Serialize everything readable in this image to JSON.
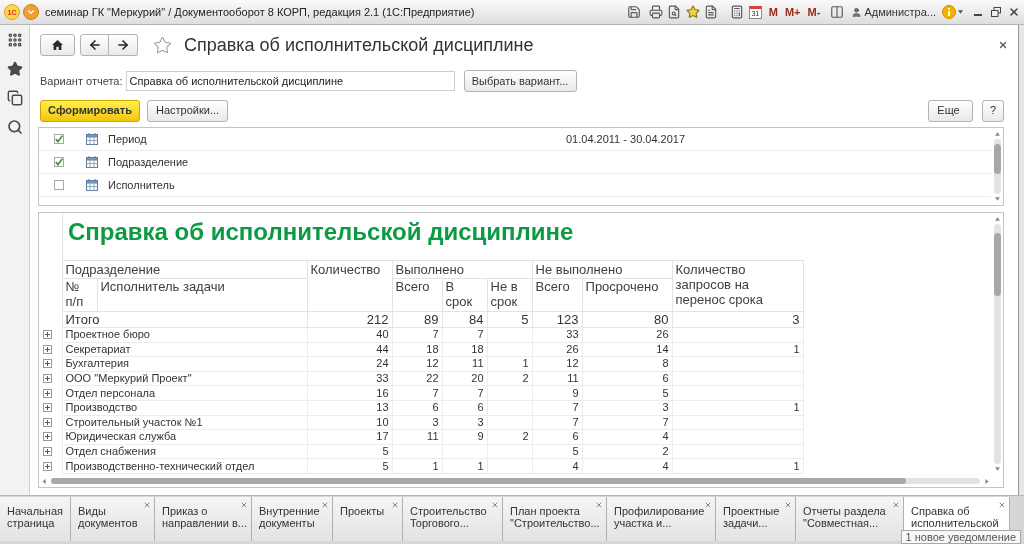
{
  "window": {
    "logo": "1С",
    "title": "семинар ГК \"Меркурий\" / Документооборот 8 КОРП, редакция 2.1 (1С:Предприятие)",
    "calendar_day": "31",
    "memory_buttons": [
      "M",
      "M+",
      "M-"
    ],
    "user": "Администра..."
  },
  "form": {
    "title": "Справка об исполнительской дисциплине",
    "favorite": false
  },
  "variant": {
    "label": "Вариант отчета:",
    "value": "Справка об исполнительской дисциплине",
    "button": "Выбрать вариант..."
  },
  "actions": {
    "generate": "Сформировать",
    "settings": "Настройки...",
    "more": "Еще",
    "help": "?"
  },
  "settings": [
    {
      "label": "Период",
      "checked": true,
      "value": "01.04.2011 - 30.04.2017"
    },
    {
      "label": "Подразделение",
      "checked": true
    },
    {
      "label": "Исполнитель",
      "checked": false
    }
  ],
  "report": {
    "title": "Справка об исполнительской дисциплине",
    "columns": {
      "department": "Подразделение",
      "number": "№ п/п",
      "executor": "Исполнитель задачи",
      "count": "Количество",
      "done": "Выполнено",
      "done_total": "Всего",
      "done_on_time": "В срок",
      "done_late": "Не в срок",
      "not_done": "Не выполнено",
      "not_done_total": "Всего",
      "overdue": "Просрочено",
      "requests": "Количество запросов на перенос срока"
    },
    "total": {
      "label": "Итого",
      "count": "212",
      "done_total": "89",
      "done_on_time": "84",
      "done_late": "5",
      "not_done_total": "123",
      "overdue": "80",
      "requests": "3"
    },
    "rows": [
      {
        "name": "Проектное бюро",
        "expanded": false,
        "count": "40",
        "done_total": "7",
        "done_on_time": "7",
        "not_done_total": "33",
        "overdue": "26"
      },
      {
        "name": "Секретариат",
        "expanded": false,
        "count": "44",
        "done_total": "18",
        "done_on_time": "18",
        "not_done_total": "26",
        "overdue": "14",
        "requests": "1"
      },
      {
        "name": "Бухгалтерия",
        "expanded": false,
        "count": "24",
        "done_total": "12",
        "done_on_time": "11",
        "done_late": "1",
        "not_done_total": "12",
        "overdue": "8"
      },
      {
        "name": "ООО \"Меркурий Проект\"",
        "expanded": false,
        "count": "33",
        "done_total": "22",
        "done_on_time": "20",
        "done_late": "2",
        "not_done_total": "11",
        "overdue": "6"
      },
      {
        "name": "Отдел персонала",
        "expanded": false,
        "count": "16",
        "done_total": "7",
        "done_on_time": "7",
        "not_done_total": "9",
        "overdue": "5"
      },
      {
        "name": "Производство",
        "expanded": false,
        "count": "13",
        "done_total": "6",
        "done_on_time": "6",
        "not_done_total": "7",
        "overdue": "3",
        "requests": "1"
      },
      {
        "name": "Строительный участок №1",
        "expanded": false,
        "count": "10",
        "done_total": "3",
        "done_on_time": "3",
        "not_done_total": "7",
        "overdue": "7"
      },
      {
        "name": "Юридическая служба",
        "expanded": false,
        "count": "17",
        "done_total": "11",
        "done_on_time": "9",
        "done_late": "2",
        "not_done_total": "6",
        "overdue": "4"
      },
      {
        "name": "Отдел снабжения",
        "expanded": false,
        "count": "5",
        "not_done_total": "5",
        "overdue": "2"
      },
      {
        "name": "Производственно-технический отдел",
        "expanded": false,
        "count": "5",
        "done_total": "1",
        "done_on_time": "1",
        "not_done_total": "4",
        "overdue": "4",
        "requests": "1"
      }
    ]
  },
  "tabs": [
    {
      "label": "Начальная страница",
      "selected": false,
      "closable": false
    },
    {
      "label": "Виды документов",
      "selected": false,
      "closable": true
    },
    {
      "label": "Приказ о направлении в...",
      "selected": false,
      "closable": true
    },
    {
      "label": "Внутренние документы",
      "selected": false,
      "closable": true
    },
    {
      "label": "Проекты",
      "selected": false,
      "closable": true
    },
    {
      "label": "Строительство Торгового...",
      "selected": false,
      "closable": true
    },
    {
      "label": "План проекта \"Строительство...",
      "selected": false,
      "closable": true
    },
    {
      "label": "Профилирование участка и...",
      "selected": false,
      "closable": true
    },
    {
      "label": "Проектные задачи...",
      "selected": false,
      "closable": true
    },
    {
      "label": "Отчеты раздела \"Совместная...",
      "selected": false,
      "closable": true
    },
    {
      "label": "Справка об исполнительской",
      "selected": true,
      "closable": true
    }
  ],
  "notification": "1 новое уведомление"
}
